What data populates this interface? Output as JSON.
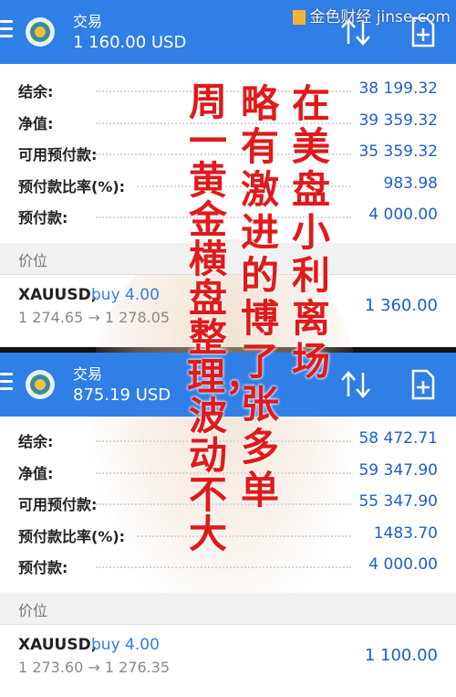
{
  "watermark": {
    "text": "金色财经 jinse.com"
  },
  "colors": {
    "appbar": "#2f7fe6",
    "value_blue": "#1e5fc9",
    "overlay_red": "#e01a1a"
  },
  "top": {
    "header": {
      "title": "交易",
      "balance": "1 160.00 USD"
    },
    "rows": [
      {
        "label": "结余:",
        "value": "38 199.32"
      },
      {
        "label": "净值:",
        "value": "39 359.32"
      },
      {
        "label": "可用预付款:",
        "value": "35 359.32"
      },
      {
        "label": "预付款比率(%):",
        "value": "983.98"
      },
      {
        "label": "预付款:",
        "value": "4 000.00"
      }
    ],
    "section_label": "价位",
    "position": {
      "symbol": "XAUUSD,",
      "side": "buy 4.00",
      "prices": "1 274.65 → 1 278.05",
      "profit": "1 360.00"
    }
  },
  "bottom": {
    "header": {
      "title": "交易",
      "balance": "875.19 USD"
    },
    "rows": [
      {
        "label": "结余:",
        "value": "58 472.71"
      },
      {
        "label": "净值:",
        "value": "59 347.90"
      },
      {
        "label": "可用预付款:",
        "value": "55 347.90"
      },
      {
        "label": "预付款比率(%):",
        "value": "1483.70"
      },
      {
        "label": "预付款:",
        "value": "4 000.00"
      }
    ],
    "section_label": "价位",
    "position": {
      "symbol": "XAUUSD,",
      "side": "buy 4.00",
      "prices": "1 273.60 → 1 276.35",
      "profit": "1 100.00"
    }
  },
  "overlay_text": {
    "col1": "在美盘小利离场",
    "col2": "略有激进的博了张多单",
    "col3": "周一黄金横盘整理，波动不大"
  }
}
